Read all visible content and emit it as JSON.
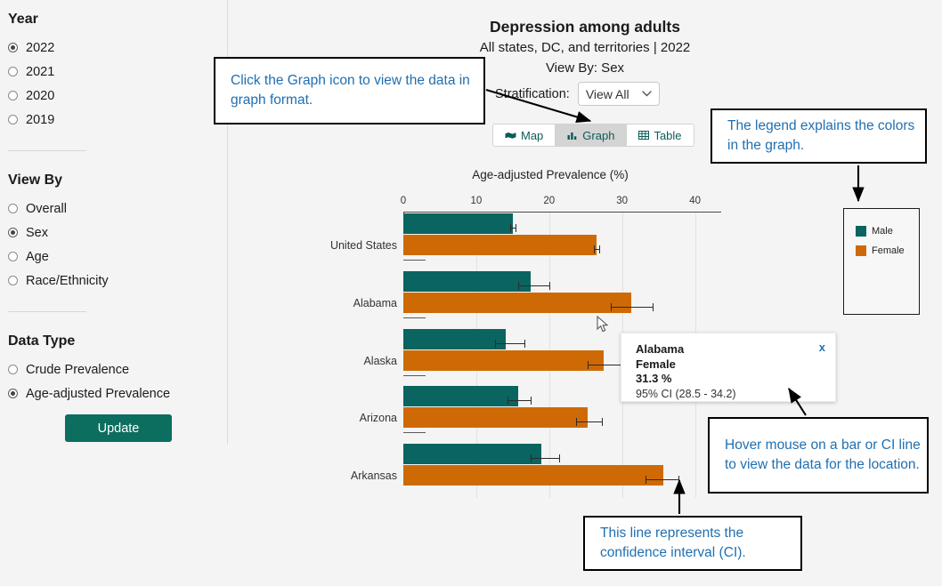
{
  "sidebar": {
    "year": {
      "heading": "Year",
      "options": [
        {
          "label": "2022",
          "selected": true
        },
        {
          "label": "2021",
          "selected": false
        },
        {
          "label": "2020",
          "selected": false
        },
        {
          "label": "2019",
          "selected": false
        }
      ]
    },
    "view_by": {
      "heading": "View By",
      "options": [
        {
          "label": "Overall",
          "selected": false
        },
        {
          "label": "Sex",
          "selected": true
        },
        {
          "label": "Age",
          "selected": false
        },
        {
          "label": "Race/Ethnicity",
          "selected": false
        }
      ]
    },
    "data_type": {
      "heading": "Data Type",
      "options": [
        {
          "label": "Crude Prevalence",
          "selected": false
        },
        {
          "label": "Age-adjusted Prevalence",
          "selected": true
        }
      ]
    },
    "update_button": "Update"
  },
  "header": {
    "title": "Depression among adults",
    "subtitle": "All states, DC, and territories | 2022",
    "view_by_line": "View By: Sex",
    "stratification_label": "Stratification:",
    "stratification_value": "View All",
    "stratification_caret": "chevron-down-icon"
  },
  "tabs": [
    {
      "label": "Map",
      "icon": "map-icon",
      "active": false
    },
    {
      "label": "Graph",
      "icon": "bar-chart-icon",
      "active": true
    },
    {
      "label": "Table",
      "icon": "table-grid-icon",
      "active": false
    }
  ],
  "tooltip": {
    "location": "Alabama",
    "group": "Female",
    "value": "31.3 %",
    "ci": "95% CI (28.5 - 34.2)",
    "close": "x"
  },
  "callouts": [
    {
      "id": "graph-icon-callout",
      "text": "Click the Graph icon to view the data in graph format."
    },
    {
      "id": "legend-callout",
      "text": "The legend explains the colors in the graph."
    },
    {
      "id": "hover-callout",
      "text": "Hover mouse on a bar or CI line to view the data for the location."
    },
    {
      "id": "ci-callout",
      "text": "This line represents the confidence interval (CI)."
    }
  ],
  "colors": {
    "male": "#0a6460",
    "female": "#ce6a05",
    "accent_teal": "#0b6e5f",
    "callout_text": "#1f6fb2",
    "background": "#f4f4f4"
  },
  "chart_data": {
    "type": "bar",
    "orientation": "horizontal",
    "title": "Depression among adults",
    "subtitle": "All states, DC, and territories | 2022",
    "xlabel": "Age-adjusted Prevalence (%)",
    "ylabel": "",
    "xlim": [
      0,
      43.5
    ],
    "xticks": [
      0,
      10,
      20,
      30,
      40
    ],
    "grid": true,
    "legend_position": "right",
    "categories": [
      "United States",
      "Alabama",
      "Alaska",
      "Arizona",
      "Arkansas"
    ],
    "series": [
      {
        "name": "Male",
        "color": "#0a6460",
        "values": [
          15.0,
          17.4,
          14.1,
          15.8,
          18.9
        ],
        "ci_low": [
          14.7,
          15.8,
          12.6,
          14.3,
          17.4
        ],
        "ci_high": [
          15.4,
          20.0,
          16.6,
          17.5,
          21.4
        ]
      },
      {
        "name": "Female",
        "color": "#ce6a05",
        "values": [
          26.5,
          31.3,
          27.5,
          25.3,
          35.6
        ],
        "ci_low": [
          26.1,
          28.5,
          25.3,
          23.7,
          33.2
        ],
        "ci_high": [
          26.9,
          34.2,
          29.8,
          27.2,
          37.7
        ]
      }
    ]
  }
}
